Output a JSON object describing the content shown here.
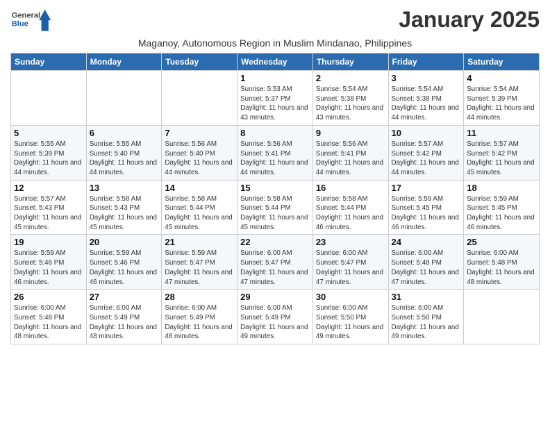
{
  "header": {
    "logo_general": "General",
    "logo_blue": "Blue",
    "month_title": "January 2025",
    "subtitle": "Maganoy, Autonomous Region in Muslim Mindanao, Philippines"
  },
  "weekdays": [
    "Sunday",
    "Monday",
    "Tuesday",
    "Wednesday",
    "Thursday",
    "Friday",
    "Saturday"
  ],
  "weeks": [
    [
      {
        "day": "",
        "info": ""
      },
      {
        "day": "",
        "info": ""
      },
      {
        "day": "",
        "info": ""
      },
      {
        "day": "1",
        "info": "Sunrise: 5:53 AM\nSunset: 5:37 PM\nDaylight: 11 hours and 43 minutes."
      },
      {
        "day": "2",
        "info": "Sunrise: 5:54 AM\nSunset: 5:38 PM\nDaylight: 11 hours and 43 minutes."
      },
      {
        "day": "3",
        "info": "Sunrise: 5:54 AM\nSunset: 5:38 PM\nDaylight: 11 hours and 44 minutes."
      },
      {
        "day": "4",
        "info": "Sunrise: 5:54 AM\nSunset: 5:39 PM\nDaylight: 11 hours and 44 minutes."
      }
    ],
    [
      {
        "day": "5",
        "info": "Sunrise: 5:55 AM\nSunset: 5:39 PM\nDaylight: 11 hours and 44 minutes."
      },
      {
        "day": "6",
        "info": "Sunrise: 5:55 AM\nSunset: 5:40 PM\nDaylight: 11 hours and 44 minutes."
      },
      {
        "day": "7",
        "info": "Sunrise: 5:56 AM\nSunset: 5:40 PM\nDaylight: 11 hours and 44 minutes."
      },
      {
        "day": "8",
        "info": "Sunrise: 5:56 AM\nSunset: 5:41 PM\nDaylight: 11 hours and 44 minutes."
      },
      {
        "day": "9",
        "info": "Sunrise: 5:56 AM\nSunset: 5:41 PM\nDaylight: 11 hours and 44 minutes."
      },
      {
        "day": "10",
        "info": "Sunrise: 5:57 AM\nSunset: 5:42 PM\nDaylight: 11 hours and 44 minutes."
      },
      {
        "day": "11",
        "info": "Sunrise: 5:57 AM\nSunset: 5:42 PM\nDaylight: 11 hours and 45 minutes."
      }
    ],
    [
      {
        "day": "12",
        "info": "Sunrise: 5:57 AM\nSunset: 5:43 PM\nDaylight: 11 hours and 45 minutes."
      },
      {
        "day": "13",
        "info": "Sunrise: 5:58 AM\nSunset: 5:43 PM\nDaylight: 11 hours and 45 minutes."
      },
      {
        "day": "14",
        "info": "Sunrise: 5:58 AM\nSunset: 5:44 PM\nDaylight: 11 hours and 45 minutes."
      },
      {
        "day": "15",
        "info": "Sunrise: 5:58 AM\nSunset: 5:44 PM\nDaylight: 11 hours and 45 minutes."
      },
      {
        "day": "16",
        "info": "Sunrise: 5:58 AM\nSunset: 5:44 PM\nDaylight: 11 hours and 46 minutes."
      },
      {
        "day": "17",
        "info": "Sunrise: 5:59 AM\nSunset: 5:45 PM\nDaylight: 11 hours and 46 minutes."
      },
      {
        "day": "18",
        "info": "Sunrise: 5:59 AM\nSunset: 5:45 PM\nDaylight: 11 hours and 46 minutes."
      }
    ],
    [
      {
        "day": "19",
        "info": "Sunrise: 5:59 AM\nSunset: 5:46 PM\nDaylight: 11 hours and 46 minutes."
      },
      {
        "day": "20",
        "info": "Sunrise: 5:59 AM\nSunset: 5:46 PM\nDaylight: 11 hours and 46 minutes."
      },
      {
        "day": "21",
        "info": "Sunrise: 5:59 AM\nSunset: 5:47 PM\nDaylight: 11 hours and 47 minutes."
      },
      {
        "day": "22",
        "info": "Sunrise: 6:00 AM\nSunset: 5:47 PM\nDaylight: 11 hours and 47 minutes."
      },
      {
        "day": "23",
        "info": "Sunrise: 6:00 AM\nSunset: 5:47 PM\nDaylight: 11 hours and 47 minutes."
      },
      {
        "day": "24",
        "info": "Sunrise: 6:00 AM\nSunset: 5:48 PM\nDaylight: 11 hours and 47 minutes."
      },
      {
        "day": "25",
        "info": "Sunrise: 6:00 AM\nSunset: 5:48 PM\nDaylight: 11 hours and 48 minutes."
      }
    ],
    [
      {
        "day": "26",
        "info": "Sunrise: 6:00 AM\nSunset: 5:48 PM\nDaylight: 11 hours and 48 minutes."
      },
      {
        "day": "27",
        "info": "Sunrise: 6:00 AM\nSunset: 5:49 PM\nDaylight: 11 hours and 48 minutes."
      },
      {
        "day": "28",
        "info": "Sunrise: 6:00 AM\nSunset: 5:49 PM\nDaylight: 11 hours and 48 minutes."
      },
      {
        "day": "29",
        "info": "Sunrise: 6:00 AM\nSunset: 5:49 PM\nDaylight: 11 hours and 49 minutes."
      },
      {
        "day": "30",
        "info": "Sunrise: 6:00 AM\nSunset: 5:50 PM\nDaylight: 11 hours and 49 minutes."
      },
      {
        "day": "31",
        "info": "Sunrise: 6:00 AM\nSunset: 5:50 PM\nDaylight: 11 hours and 49 minutes."
      },
      {
        "day": "",
        "info": ""
      }
    ]
  ]
}
